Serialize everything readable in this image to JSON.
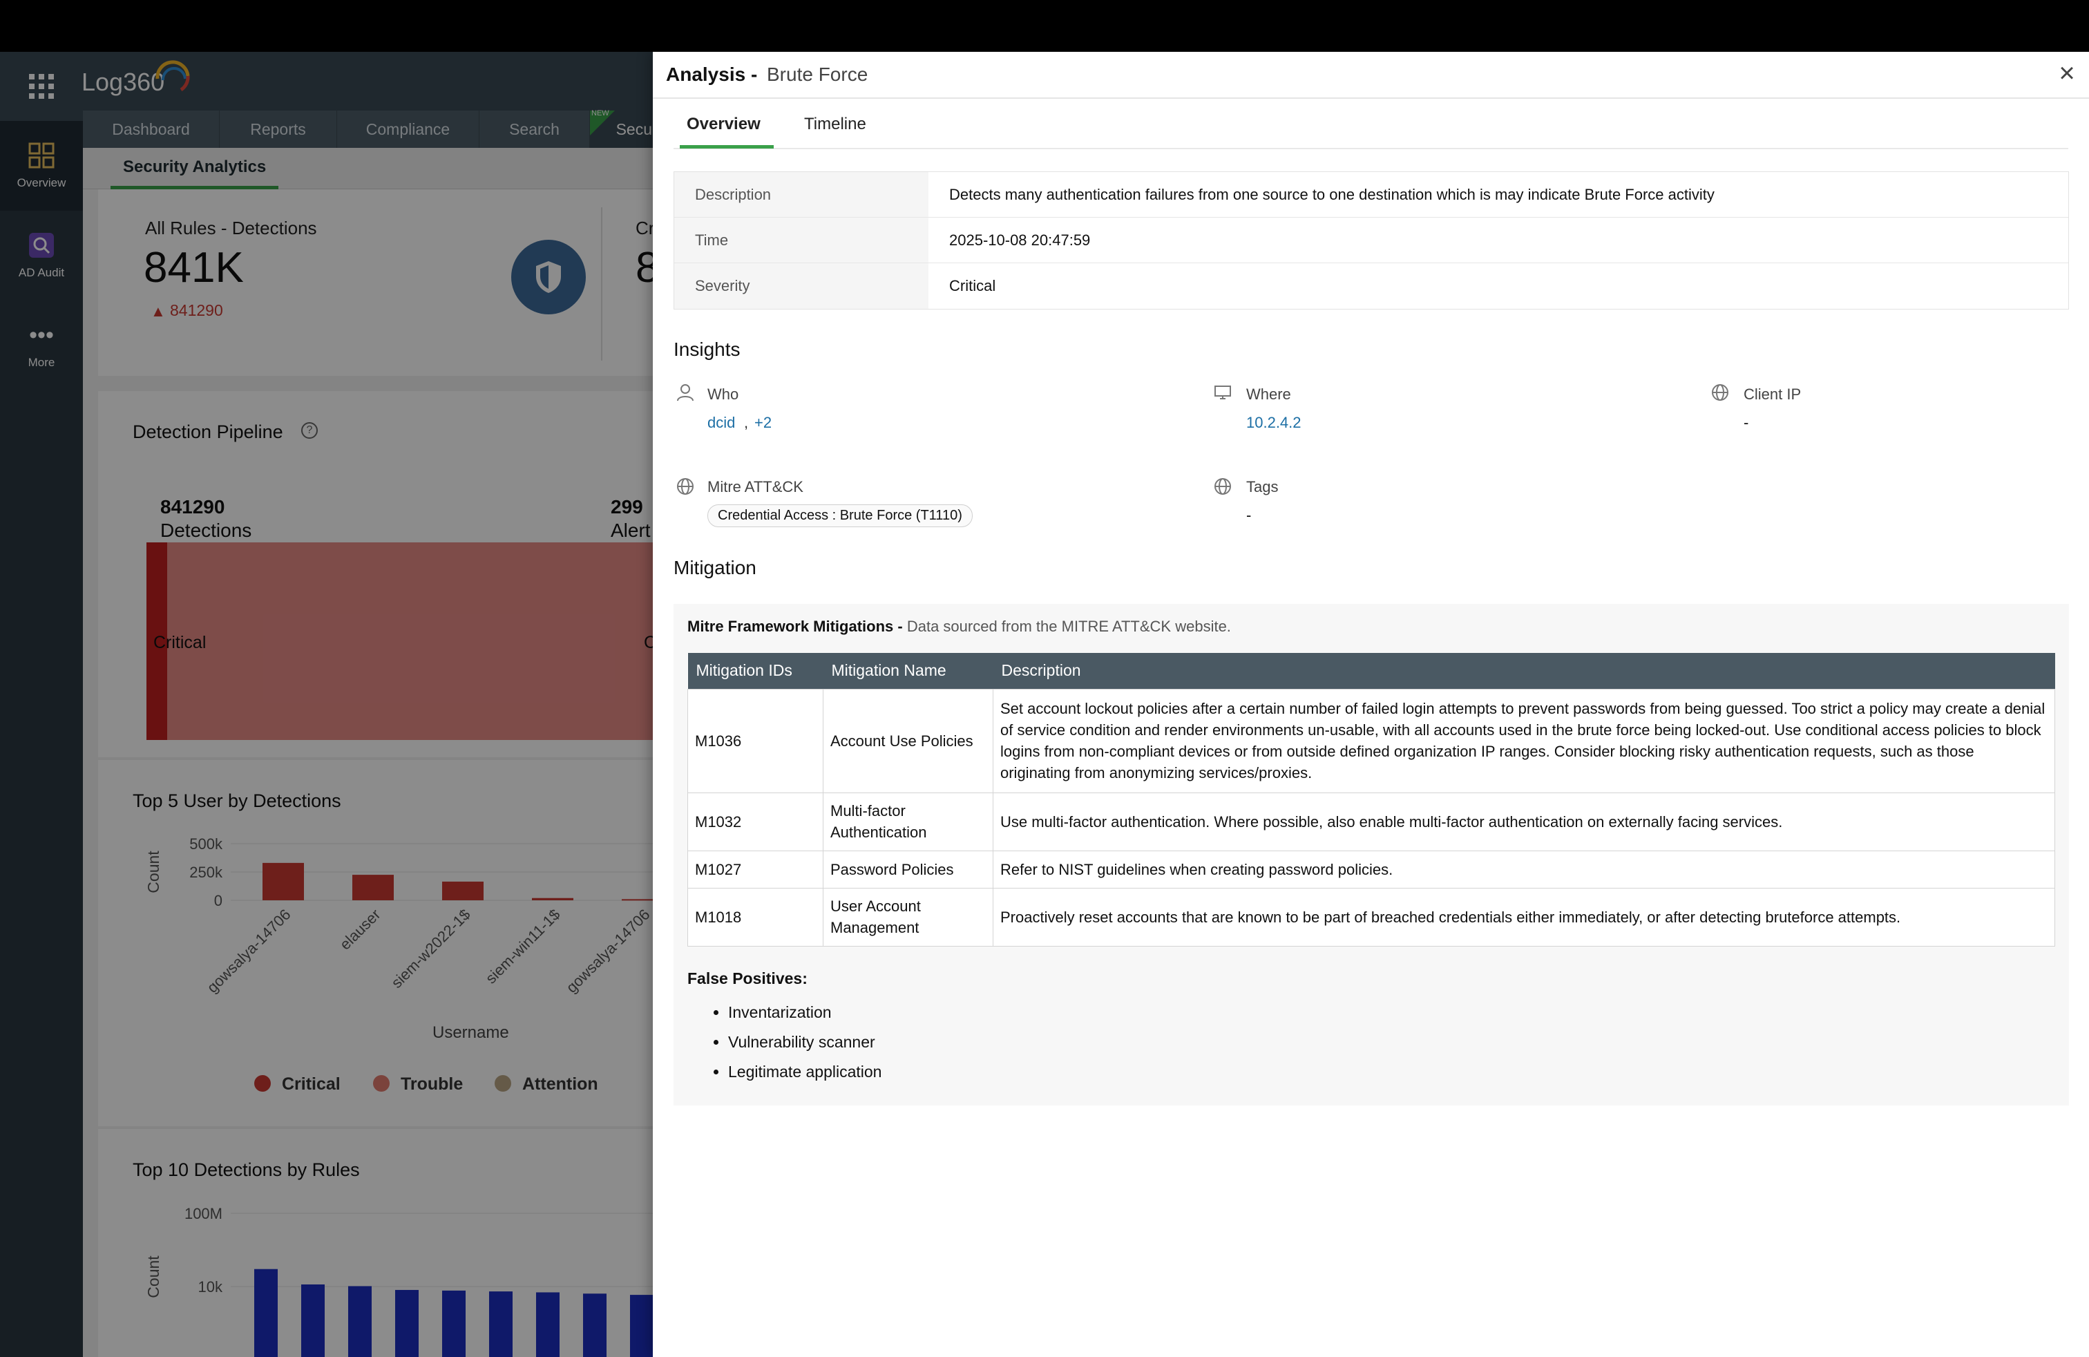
{
  "app": {
    "logo": "Log360",
    "rail": [
      {
        "label": "Overview",
        "icon": "overview-icon"
      },
      {
        "label": "AD Audit",
        "icon": "ad-audit-icon"
      },
      {
        "label": "More",
        "icon": "more-icon"
      }
    ],
    "nav": {
      "dashboard": "Dashboard",
      "reports": "Reports",
      "compliance": "Compliance",
      "search": "Search",
      "security": "Secu",
      "new_badge": "NEW"
    },
    "subtab": "Security Analytics"
  },
  "dashboard": {
    "all_rules_title": "All Rules - Detections",
    "all_rules_value": "841K",
    "all_rules_delta": "841290",
    "second_card_partial_title": "Cr",
    "second_card_partial_value": "8",
    "pipeline_title": "Detection Pipeline",
    "pipeline_detections_count": "841290",
    "pipeline_detections_label": "Detections",
    "pipeline_alerts_count": "299",
    "pipeline_alerts_label": "Alert",
    "pipeline_critical": "Critical",
    "pipeline_partial": "C",
    "top5_title": "Top 5 User by Detections",
    "top5_xlabel": "Username",
    "top5_ylabel": "Count",
    "legend": [
      "Critical",
      "Trouble",
      "Attention"
    ],
    "top10_title": "Top 10 Detections by Rules",
    "top10_ylabel": "Count"
  },
  "chart_data": [
    {
      "type": "bar",
      "title": "Top 5 User by Detections",
      "xlabel": "Username",
      "ylabel": "Count",
      "categories": [
        "gowsalya-14706",
        "elauser",
        "siem-w2022-1$",
        "siem-win11-1$",
        "gowsalya-14706"
      ],
      "ticks": [
        "500k",
        "250k",
        "0"
      ],
      "ylim": [
        0,
        500000
      ],
      "series": [
        {
          "name": "Critical",
          "values": [
            330000,
            225000,
            165000,
            20000,
            10000
          ]
        }
      ],
      "legend": [
        "Critical",
        "Trouble",
        "Attention"
      ],
      "colors": {
        "Critical": "#c83a32",
        "Trouble": "#e07a6e",
        "Attention": "#b8a583"
      }
    },
    {
      "type": "bar",
      "title": "Top 10 Detections by Rules",
      "ylabel": "Count",
      "ticks": [
        "100M",
        "10k"
      ],
      "scale": "log",
      "values": [
        90000,
        13000,
        10500,
        6500,
        6000,
        5400,
        4800,
        4100,
        3500
      ],
      "color": "#1c2fc0"
    }
  ],
  "panel": {
    "title": "Analysis -",
    "subtitle": "Brute Force",
    "tabs": [
      "Overview",
      "Timeline"
    ],
    "info": {
      "description_label": "Description",
      "description": "Detects many authentication failures from one source to one destination which is may indicate Brute Force activity",
      "time_label": "Time",
      "time": "2025-10-08 20:47:59",
      "severity_label": "Severity",
      "severity": "Critical"
    },
    "insights": {
      "heading": "Insights",
      "who_label": "Who",
      "who_value": "dcid",
      "who_sep": ",",
      "who_more": "+2",
      "where_label": "Where",
      "where_value": "10.2.4.2",
      "client_ip_label": "Client IP",
      "client_ip_value": "-",
      "mitre_label": "Mitre ATT&CK",
      "mitre_chip": "Credential Access : Brute Force (T1110)",
      "tags_label": "Tags",
      "tags_value": "-"
    },
    "mitigation": {
      "heading": "Mitigation",
      "framework_title": "Mitre Framework Mitigations -",
      "framework_note": "Data sourced from the MITRE ATT&CK website.",
      "columns": [
        "Mitigation IDs",
        "Mitigation Name",
        "Description"
      ],
      "rows": [
        {
          "id": "M1036",
          "name": "Account Use Policies",
          "desc": "Set account lockout policies after a certain number of failed login attempts to prevent passwords from being guessed. Too strict a policy may create a denial of service condition and render environments un-usable, with all accounts used in the brute force being locked-out. Use conditional access policies to block logins from non-compliant devices or from outside defined organization IP ranges. Consider blocking risky authentication requests, such as those originating from anonymizing services/proxies."
        },
        {
          "id": "M1032",
          "name": "Multi-factor Authentication",
          "desc": "Use multi-factor authentication. Where possible, also enable multi-factor authentication on externally facing services."
        },
        {
          "id": "M1027",
          "name": "Password Policies",
          "desc": "Refer to NIST guidelines when creating password policies."
        },
        {
          "id": "M1018",
          "name": "User Account Management",
          "desc": "Proactively reset accounts that are known to be part of breached credentials either immediately, or after detecting bruteforce attempts."
        }
      ],
      "false_positives_title": "False Positives:",
      "false_positives": [
        "Inventarization",
        "Vulnerability scanner",
        "Legitimate application"
      ]
    }
  }
}
